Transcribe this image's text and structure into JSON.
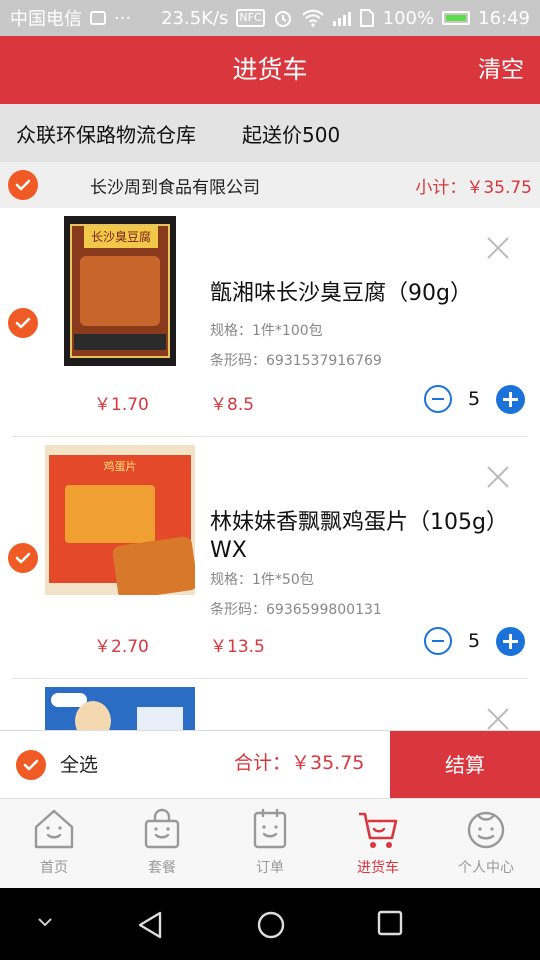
{
  "status_bar": {
    "carrier": "中国电信",
    "dots": "···",
    "speed": "23.5K/s",
    "nfc": "NFC",
    "battery": "100%",
    "time": "16:49"
  },
  "header": {
    "title": "进货车",
    "clear_label": "清空"
  },
  "warehouse": {
    "name": "众联环保路物流仓库",
    "min_order": "起送价500"
  },
  "supplier": {
    "name": "长沙周到食品有限公司",
    "subtotal": "小计：￥35.75"
  },
  "items": [
    {
      "name": "甑湘味长沙臭豆腐（90g）",
      "spec": "规格：1件*100包",
      "barcode": "条形码：6931537916769",
      "unit_price": "￥1.70",
      "total_price": "￥8.5",
      "qty": "5",
      "thumb_label": "长沙臭豆腐"
    },
    {
      "name": "林妹妹香飘飘鸡蛋片（105g）WX",
      "spec": "规格：1件*50包",
      "barcode": "条形码：6936599800131",
      "unit_price": "￥2.70",
      "total_price": "￥13.5",
      "qty": "5",
      "thumb_label": "鸡蛋片"
    }
  ],
  "summary": {
    "select_all": "全选",
    "total": "合计：￥35.75",
    "checkout": "结算"
  },
  "tabs": [
    {
      "label": "首页",
      "icon": "home-icon"
    },
    {
      "label": "套餐",
      "icon": "bag-icon"
    },
    {
      "label": "订单",
      "icon": "order-icon"
    },
    {
      "label": "进货车",
      "icon": "cart-icon"
    },
    {
      "label": "个人中心",
      "icon": "profile-icon"
    }
  ],
  "colors": {
    "brand_red": "#d9363e",
    "check_orange": "#f05a24",
    "accent_blue": "#1b72d8"
  }
}
